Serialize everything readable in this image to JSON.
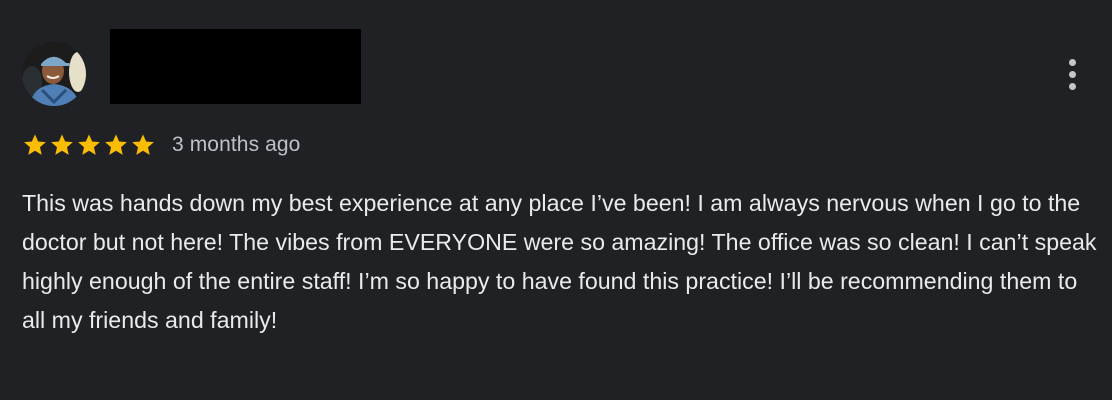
{
  "review": {
    "rating": 5,
    "rating_max": 5,
    "timestamp": "3 months ago",
    "text": "This was hands down my best experience at any place I’ve been! I am always nervous when I go to the doctor but not here! The vibes from EVERYONE were so amazing! The office was so clean! I can’t speak highly enough of the entire staff! I’m so happy to have found this practice! I’ll be recommending them to all my friends and family!"
  },
  "icons": {
    "star": "star-icon",
    "more": "more-vert-icon"
  },
  "colors": {
    "background": "#202124",
    "star": "#fbbc04",
    "text": "#e8eaed",
    "muted_text": "#bdc1c6",
    "redaction": "#000000"
  }
}
